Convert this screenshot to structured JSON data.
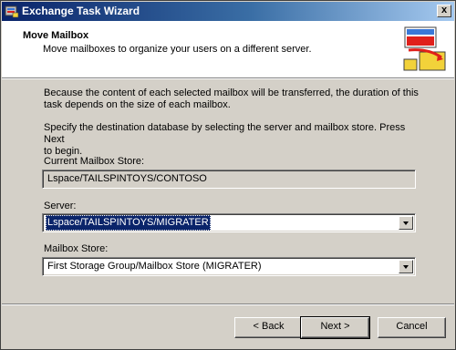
{
  "window": {
    "title": "Exchange Task Wizard",
    "close_label": "x"
  },
  "header": {
    "title": "Move Mailbox",
    "subtitle": "Move mailboxes to organize your users on a different server."
  },
  "body": {
    "paragraph1_line1": "Because the content of each selected mailbox will be transferred, the duration of this",
    "paragraph1_line2": "task depends on the size of each mailbox.",
    "paragraph2_line1": "Specify the destination database by selecting the server and mailbox store. Press Next",
    "paragraph2_line2": "to begin."
  },
  "fields": {
    "current_store_label": "Current Mailbox Store:",
    "current_store_value": "Lspace/TAILSPINTOYS/CONTOSO",
    "server_label": "Server:",
    "server_value": "Lspace/TAILSPINTOYS/MIGRATER",
    "mailbox_store_label": "Mailbox Store:",
    "mailbox_store_value": "First Storage Group/Mailbox Store (MIGRATER)"
  },
  "buttons": {
    "back": "< Back",
    "next": "Next >",
    "cancel": "Cancel"
  },
  "colors": {
    "title_bar": "#0a246a",
    "dialog_face": "#d4d0c8",
    "selection": "#0a246a",
    "icon_red": "#e0201b",
    "icon_blue": "#3a78d8",
    "icon_yellow": "#f2d23a"
  },
  "icons": {
    "title_icon": "exchange-app-icon",
    "header_icon": "move-mailbox-icon",
    "dropdown_icon": "chevron-down-icon"
  }
}
